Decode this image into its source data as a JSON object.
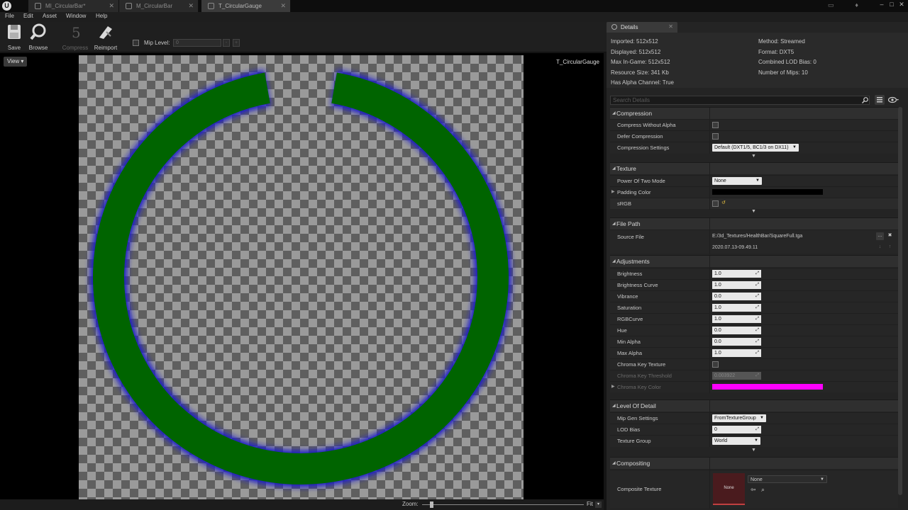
{
  "tabs": [
    {
      "label": "MI_CircularBar*",
      "active": false
    },
    {
      "label": "M_CircularBar",
      "active": false
    },
    {
      "label": "T_CircularGauge",
      "active": true
    }
  ],
  "menu": [
    "File",
    "Edit",
    "Asset",
    "Window",
    "Help"
  ],
  "toolbar": {
    "save": "Save",
    "browse": "Browse",
    "compress": "Compress",
    "reimport": "Reimport",
    "mip_label": "Mip Level:",
    "mip_value": "0"
  },
  "viewport": {
    "view_button": "View",
    "texture_name": "T_CircularGauge",
    "zoom_label": "Zoom:",
    "zoom_mode": "Fit"
  },
  "details": {
    "tab_label": "Details",
    "info_left": [
      "Imported: 512x512",
      "Displayed: 512x512",
      "Max In-Game: 512x512",
      "Resource Size: 341 Kb",
      "Has Alpha Channel: True"
    ],
    "info_right": [
      "Method: Streamed",
      "Format: DXT5",
      "Combined LOD Bias: 0",
      "Number of Mips: 10"
    ],
    "search_placeholder": "Search Details",
    "compression": {
      "title": "Compression",
      "compress_without_alpha": "Compress Without Alpha",
      "defer_compression": "Defer Compression",
      "compression_settings": "Compression Settings",
      "compression_settings_value": "Default (DXT1/5, BC1/3 on DX11)"
    },
    "texture": {
      "title": "Texture",
      "power_of_two_mode": "Power Of Two Mode",
      "power_of_two_value": "None",
      "padding_color": "Padding Color",
      "padding_color_hex": "#000000",
      "srgb": "sRGB"
    },
    "file_path": {
      "title": "File Path",
      "source_file": "Source File",
      "source_file_value": "E:/3d_Textures/HealthBar/SquareFull.tga",
      "timestamp": "2020.07.13-09.49.11"
    },
    "adjustments": {
      "title": "Adjustments",
      "rows": [
        {
          "label": "Brightness",
          "value": "1.0"
        },
        {
          "label": "Brightness Curve",
          "value": "1.0"
        },
        {
          "label": "Vibrance",
          "value": "0.0"
        },
        {
          "label": "Saturation",
          "value": "1.0"
        },
        {
          "label": "RGBCurve",
          "value": "1.0"
        },
        {
          "label": "Hue",
          "value": "0.0"
        },
        {
          "label": "Min Alpha",
          "value": "0.0"
        },
        {
          "label": "Max Alpha",
          "value": "1.0"
        }
      ],
      "chroma_key_texture": "Chroma Key Texture",
      "chroma_key_threshold": "Chroma Key Threshold",
      "chroma_key_threshold_value": "0.003922",
      "chroma_key_color": "Chroma Key Color",
      "chroma_key_color_hex": "#ff00ff"
    },
    "level_of_detail": {
      "title": "Level Of Detail",
      "mip_gen_settings": "Mip Gen Settings",
      "mip_gen_value": "FromTextureGroup",
      "lod_bias": "LOD Bias",
      "lod_bias_value": "0",
      "texture_group": "Texture Group",
      "texture_group_value": "World"
    },
    "compositing": {
      "title": "Compositing",
      "composite_texture": "Composite Texture",
      "thumb_label": "None",
      "composite_value": "None"
    }
  },
  "colors": {
    "ring_fill": "#006400",
    "ring_glow": "#1a1acc",
    "chroma_key": "#ff00ff"
  }
}
